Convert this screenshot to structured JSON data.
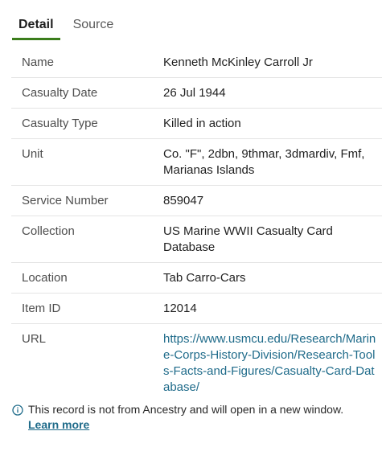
{
  "tabs": [
    {
      "label": "Detail",
      "active": true
    },
    {
      "label": "Source",
      "active": false
    }
  ],
  "rows": [
    {
      "label": "Name",
      "value": "Kenneth McKinley Carroll Jr"
    },
    {
      "label": "Casualty Date",
      "value": "26 Jul 1944"
    },
    {
      "label": "Casualty Type",
      "value": "Killed in action"
    },
    {
      "label": "Unit",
      "value": "Co. \"F\", 2dbn, 9thmar, 3dmardiv, Fmf, Marianas Islands"
    },
    {
      "label": "Service Number",
      "value": "859047"
    },
    {
      "label": "Collection",
      "value": "US Marine WWII Casualty Card Database"
    },
    {
      "label": "Location",
      "value": "Tab Carro-Cars"
    },
    {
      "label": "Item ID",
      "value": "12014"
    },
    {
      "label": "URL",
      "value": "https://www.usmcu.edu/Research/Marine-Corps-History-Division/Research-Tools-Facts-and-Figures/Casualty-Card-Database/"
    }
  ],
  "notice": {
    "text": "This record is not from Ancestry and will open in a new window.",
    "link_label": "Learn more",
    "icon": "info-icon"
  },
  "colors": {
    "accent": "#3b7d1c",
    "link": "#1f6b8a",
    "divider": "#e4e4e4"
  }
}
